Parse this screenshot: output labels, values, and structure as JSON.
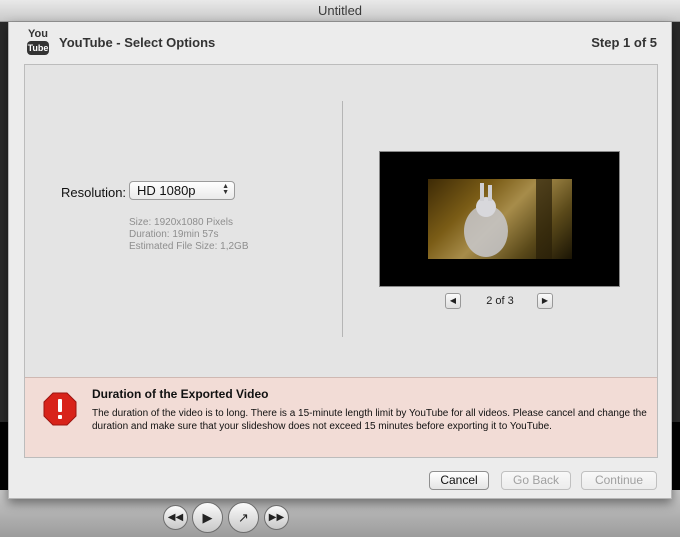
{
  "window": {
    "title": "Untitled"
  },
  "header": {
    "logo_top": "You",
    "logo_bottom": "Tube",
    "title": "YouTube - Select Options",
    "step": "Step 1 of 5"
  },
  "options": {
    "resolution_label": "Resolution:",
    "resolution_value": "HD 1080p",
    "info": [
      "Size: 1920x1080 Pixels",
      "Duration: 19min 57s",
      "Estimated File Size: 1,2GB"
    ]
  },
  "preview": {
    "counter": "2 of 3",
    "prev_icon": "triangle-left-icon",
    "next_icon": "triangle-right-icon"
  },
  "warning": {
    "icon": "stop-sign-icon",
    "title": "Duration of the Exported Video",
    "text": "The duration of the video is to long. There is a 15-minute length limit by YouTube for all videos. Please cancel and change the duration and make sure that your slideshow does not exceed 15 minutes before exporting it to YouTube.",
    "color": "#f2dcd6"
  },
  "buttons": {
    "cancel": "Cancel",
    "go_back": "Go Back",
    "continue": "Continue"
  },
  "player": {
    "icons": [
      "rewind-icon",
      "play-icon",
      "share-icon",
      "fast-forward-icon"
    ]
  }
}
